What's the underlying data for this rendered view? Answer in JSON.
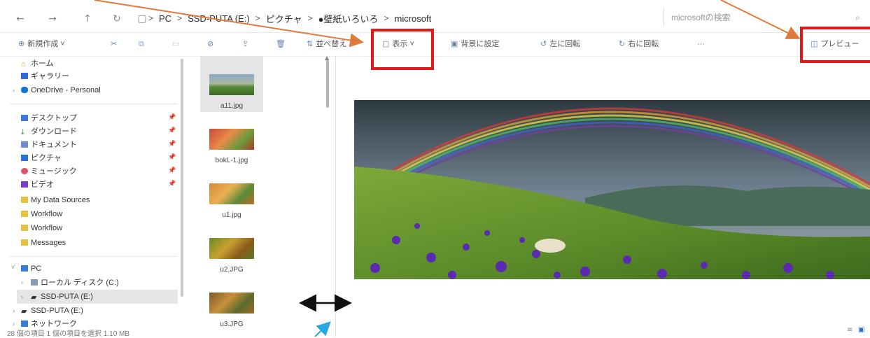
{
  "nav": {
    "back": "←",
    "forward": "→",
    "up": "↑",
    "refresh": "↻",
    "location_icon": "▢"
  },
  "breadcrumb": [
    "PC",
    "SSD-PUTA (E:)",
    "ピクチャ",
    "●壁紙いろいろ",
    "microsoft"
  ],
  "breadcrumb_sep": ">",
  "search": {
    "placeholder": "microsoftの検索"
  },
  "toolbar": {
    "new": "新規作成",
    "sort": "並べ替え",
    "view": "表示",
    "set_background": "背景に設定",
    "rotate_left": "左に回転",
    "rotate_right": "右に回転",
    "more": "···",
    "preview": "プレビュー"
  },
  "sidebar": {
    "home": "ホーム",
    "gallery": "ギャラリー",
    "onedrive": "OneDrive - Personal",
    "desktop": "デスクトップ",
    "downloads": "ダウンロード",
    "documents": "ドキュメント",
    "pictures": "ピクチャ",
    "music": "ミュージック",
    "videos": "ビデオ",
    "mydata": "My Data Sources",
    "workflow1": "Workflow",
    "workflow2": "Workflow",
    "messages": "Messages",
    "pc": "PC",
    "local_disk": "ローカル ディスク (C:)",
    "ssd1": "SSD-PUTA (E:)",
    "ssd2": "SSD-PUTA (E:)",
    "network": "ネットワーク"
  },
  "files": [
    {
      "name": "a11.jpg"
    },
    {
      "name": "bokL-1.jpg"
    },
    {
      "name": "u1.jpg"
    },
    {
      "name": "u2.JPG"
    },
    {
      "name": "u3.JPG"
    }
  ],
  "status": "28 個の項目    1 個の項目を選択  1.10 MB",
  "colors": {
    "highlight_box": "#e01a1a",
    "arrow_orange": "#e07a3a",
    "arrow_cyan": "#28a8e0",
    "selected_bg": "#e5e5e5"
  }
}
